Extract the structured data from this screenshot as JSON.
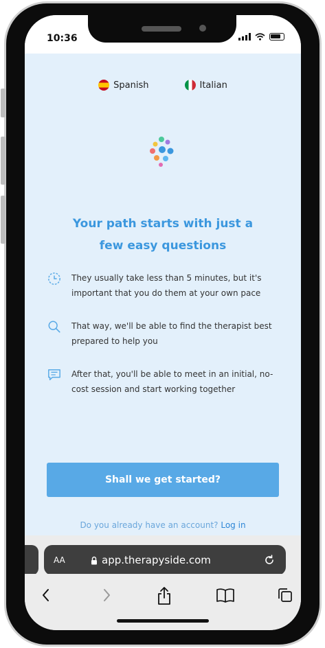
{
  "status_bar": {
    "time": "10:36"
  },
  "languages": [
    {
      "label": "Spanish",
      "flag": "flag-spain-icon"
    },
    {
      "label": "Italian",
      "flag": "flag-italy-icon"
    }
  ],
  "headline": {
    "line1": "Your path starts with just a",
    "line2": "few easy questions"
  },
  "features": [
    {
      "icon": "clock-icon",
      "text": "They usually take less than 5 minutes, but it's important that you do them at your own pace"
    },
    {
      "icon": "search-icon",
      "text": "That way, we'll be able to find the therapist best prepared to help you"
    },
    {
      "icon": "chat-icon",
      "text": "After that, you'll be able to meet in an initial, no-cost session and start working together"
    }
  ],
  "cta_label": "Shall we get started?",
  "login": {
    "prompt": "Do you already have an account?",
    "link": "Log in"
  },
  "browser": {
    "text_size_label": "AA",
    "url": "app.therapyside.com",
    "lock_icon": "lock-icon",
    "reload_icon": "reload-icon",
    "toolbar": [
      "back-icon",
      "forward-icon",
      "share-icon",
      "bookmarks-icon",
      "tabs-icon"
    ]
  },
  "colors": {
    "accent": "#3b97de",
    "button": "#58a9e6",
    "background": "#e3f0fb"
  }
}
